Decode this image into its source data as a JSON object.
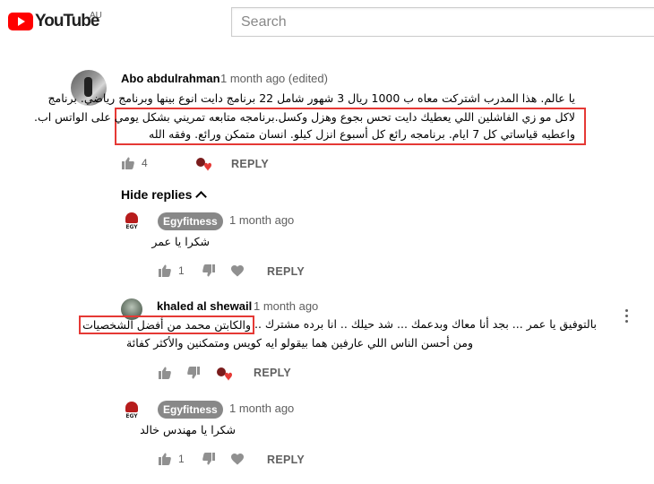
{
  "header": {
    "logo_text": "YouTube",
    "region": "AU",
    "search_placeholder": "Search"
  },
  "comments": [
    {
      "author": "Abo abdulrahman",
      "time": "1 month ago (edited)",
      "lines": [
        "يا عالم. هذا المدرب اشتركت معاه ب 1000 ريال 3 شهور شامل 22 برنامج دايت انوع بينها وبرنامج رياضي. برنامج",
        "لاكل مو زي الفاشلين اللي يعطيك دايت تحس بجوع وهزل وكسل.برنامجه متابعه تمريني بشكل يومي على الواتس اب.",
        "واعطيه قياساتي كل 7 ايام. برنامجه رائع كل أسبوع انزل كيلو. انسان متمكن ورائع. وفقه الله"
      ],
      "likes": "4",
      "reply_label": "REPLY"
    }
  ],
  "hide_replies_label": "Hide replies",
  "replies": [
    {
      "author": "Egyfitness",
      "time": "1 month ago",
      "text": "شكرا يا عمر",
      "likes": "1",
      "reply_label": "REPLY"
    },
    {
      "author": "khaled al shewail",
      "time": "1 month ago",
      "line1_plain": "بالتوفيق يا عمر ... بجد أنا معاك وبدعمك ... شد حيلك .. انا برده مشترك .. ",
      "line1_boxed": "والكابتن محمد من أفضل الشخصيات",
      "line2": "ومن أحسن الناس اللي عارفين هما بيقولو ايه كويس ومتمكنين والأكثر كفائة",
      "reply_label": "REPLY"
    },
    {
      "author": "Egyfitness",
      "time": "1 month ago",
      "text": "شكرا يا مهندس خالد",
      "likes": "1",
      "reply_label": "REPLY"
    }
  ],
  "avatar_text": "EGY",
  "colors": {
    "highlight_border": "#e53935",
    "heart": "#e53935",
    "brand_red": "#ff0000"
  }
}
